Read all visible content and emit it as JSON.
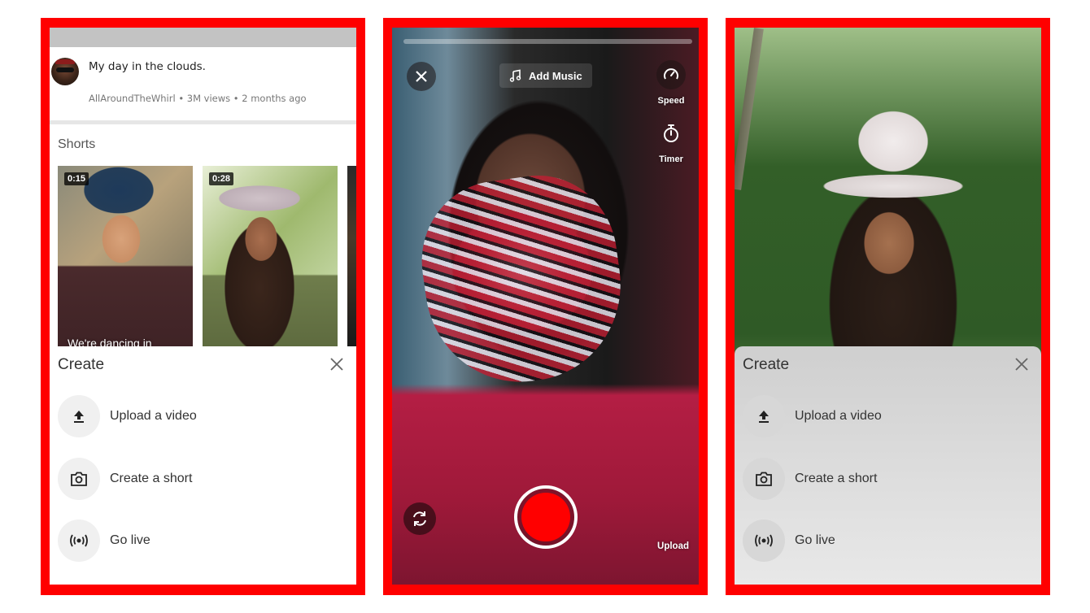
{
  "phones": [
    {
      "id": "home-create-sheet",
      "video": {
        "title": "My day in the clouds.",
        "channel": "AllAroundTheWhirl",
        "views": "3M views",
        "age": "2 months ago",
        "meta_line": "AllAroundTheWhirl • 3M views • 2 months ago"
      },
      "shorts_section": {
        "label": "Shorts",
        "items": [
          {
            "duration": "0:15",
            "caption": "We're dancing in"
          },
          {
            "duration": "0:28",
            "caption": ""
          }
        ]
      },
      "create_sheet": {
        "title": "Create",
        "close_icon": "close-icon",
        "items": [
          {
            "label": "Upload a video",
            "icon": "upload-icon"
          },
          {
            "label": "Create a short",
            "icon": "camera-icon"
          },
          {
            "label": "Go live",
            "icon": "live-broadcast-icon"
          }
        ]
      }
    },
    {
      "id": "shorts-camera",
      "camera": {
        "close_icon": "close-icon",
        "add_music_label": "Add Music",
        "music_icon": "music-note-icon",
        "speed_label": "Speed",
        "timer_label": "Timer",
        "flip_icon": "flip-camera-icon",
        "upload_label": "Upload",
        "record_color": "#ff0000"
      }
    },
    {
      "id": "portrait-create-sheet",
      "create_sheet": {
        "title": "Create",
        "close_icon": "close-icon",
        "items": [
          {
            "label": "Upload a video",
            "icon": "upload-icon"
          },
          {
            "label": "Create a short",
            "icon": "camera-icon"
          },
          {
            "label": "Go live",
            "icon": "live-broadcast-icon"
          }
        ]
      }
    }
  ],
  "colors": {
    "frame_border": "#ff0000",
    "record_button": "#ff0000",
    "status_bar": "#c3c3c3"
  }
}
